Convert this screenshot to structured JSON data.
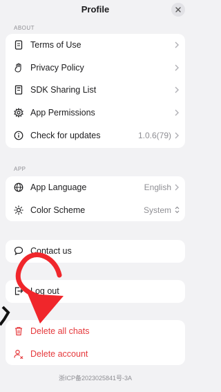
{
  "header": {
    "title": "Profile",
    "close_icon": "close-icon"
  },
  "about": {
    "label": "ABOUT",
    "items": [
      {
        "label": "Terms of Use",
        "icon": "document-icon",
        "value": ""
      },
      {
        "label": "Privacy Policy",
        "icon": "hand-icon",
        "value": ""
      },
      {
        "label": "SDK Sharing List",
        "icon": "list-icon",
        "value": ""
      },
      {
        "label": "App Permissions",
        "icon": "gear-icon",
        "value": ""
      },
      {
        "label": "Check for updates",
        "icon": "info-icon",
        "value": "1.0.6(79)"
      }
    ]
  },
  "app": {
    "label": "APP",
    "items": [
      {
        "label": "App Language",
        "icon": "globe-icon",
        "value": "English"
      },
      {
        "label": "Color Scheme",
        "icon": "sun-icon",
        "value": "System"
      }
    ]
  },
  "contact": {
    "label": "Contact us",
    "icon": "chat-bubble-icon"
  },
  "logout": {
    "label": "Log out",
    "icon": "logout-icon"
  },
  "danger": {
    "items": [
      {
        "label": "Delete all chats",
        "icon": "trash-icon"
      },
      {
        "label": "Delete account",
        "icon": "user-remove-icon"
      }
    ]
  },
  "footer": {
    "text": "浙ICP备2023025841号-3A"
  },
  "colors": {
    "danger": "#e5383b",
    "annotation_arrow": "#f0262b",
    "muted": "#8e8e93"
  }
}
